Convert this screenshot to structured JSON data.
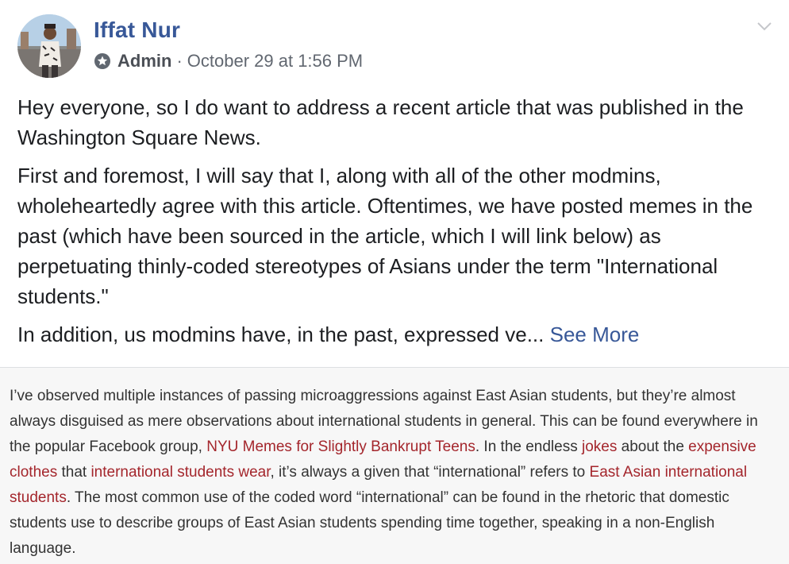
{
  "post": {
    "author": "Iffat Nur",
    "role": "Admin",
    "separator": "·",
    "timestamp": "October 29 at 1:56 PM",
    "paragraphs": [
      "Hey everyone, so I do want to address a recent article that was published in the Washington Square News.",
      "First and foremost, I will say that I, along with all of the other modmins, wholeheartedly agree with this article. Oftentimes, we have posted memes in the past (which have been sourced in the article, which I will link below) as perpetuating thinly-coded stereotypes of Asians under the term \"International students.\""
    ],
    "truncated_paragraph": "In addition, us modmins have, in the past, expressed ve...",
    "see_more": "See More",
    "icons": {
      "admin_badge": "admin-badge-icon",
      "options": "chevron-down-icon"
    },
    "colors": {
      "name": "#385898",
      "meta": "#616770",
      "excerpt_link": "#a4262c"
    }
  },
  "excerpt": {
    "t1": "I’ve observed multiple instances of passing microaggressions against East Asian students, but they’re almost always disguised as mere observations about international students in general. This can be found everywhere in the popular Facebook group, ",
    "link1": "NYU Memes for Slightly Bankrupt Teens",
    "t2": ". In the endless ",
    "link2": "jokes",
    "t3": " about the ",
    "link3": "expensive clothes",
    "t4": " that ",
    "link4": "international students wear",
    "t5": ", it’s always a given that “international” refers to ",
    "link5": "East Asian international students",
    "t6": ". The most common use of the coded word “international” can be found in the rhetoric that domestic students use to describe groups of East Asian students spending time together, speaking in a non-English language."
  }
}
